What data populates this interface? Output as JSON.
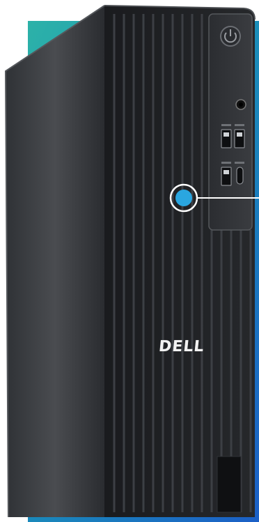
{
  "product": {
    "brand_logo_text": "DELL",
    "colors": {
      "backdrop_teal": "#1aa6b0",
      "backdrop_blue": "#1b63c5",
      "chassis_dark": "#1e1f22",
      "side_panel": "#3a3c40",
      "hotspot_blue": "#2aa6e0"
    }
  }
}
